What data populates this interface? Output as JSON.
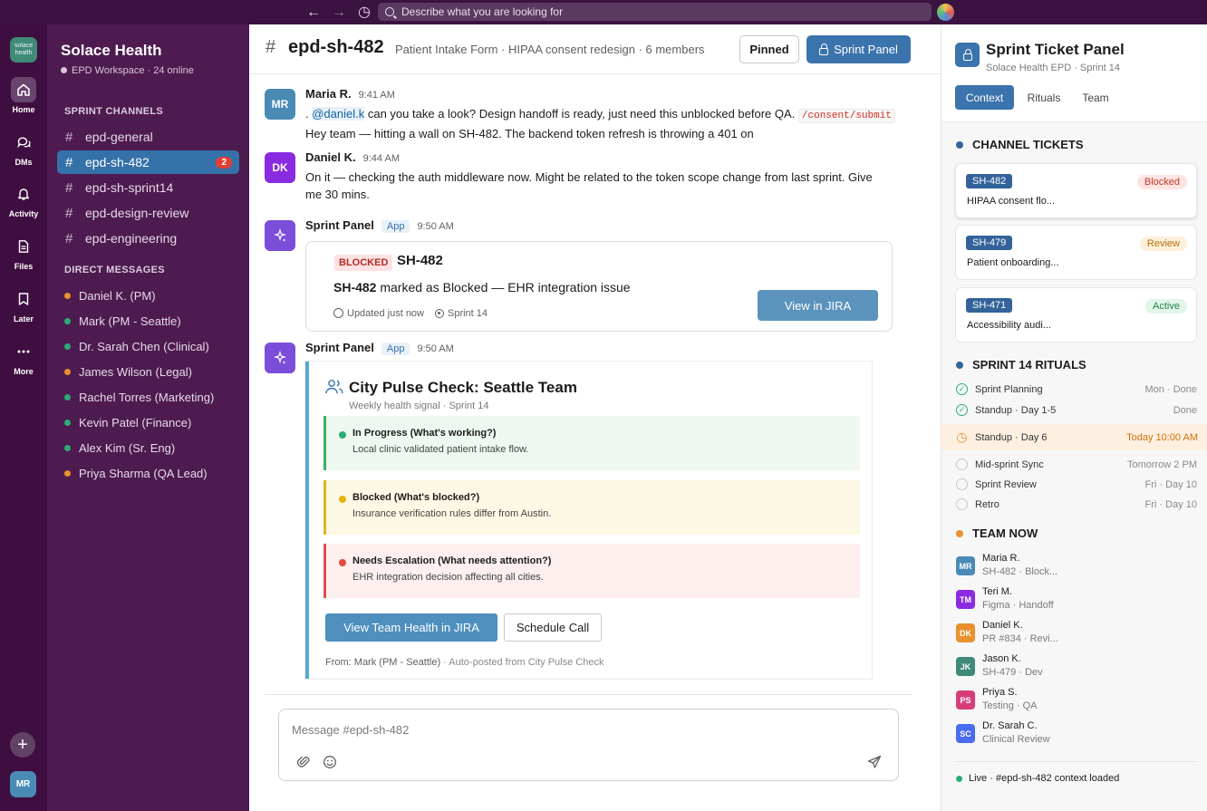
{
  "topbar": {
    "back": "←",
    "forward": "→",
    "history": "◷",
    "search_placeholder": "Describe what you are looking for"
  },
  "rail": {
    "workspace_logo": "solace health",
    "items": [
      {
        "label": "Home",
        "icon": "home-icon"
      },
      {
        "label": "DMs",
        "icon": "dms-icon"
      },
      {
        "label": "Activity",
        "icon": "bell-icon"
      },
      {
        "label": "Files",
        "icon": "file-icon"
      },
      {
        "label": "Later",
        "icon": "bookmark-icon"
      },
      {
        "label": "More",
        "icon": "more-icon"
      }
    ],
    "add": "+",
    "me": "MR"
  },
  "sidebar": {
    "workspace": "Solace Health",
    "subtitle": "EPD Workspace · 24 online",
    "channels_header": "SPRINT CHANNELS",
    "channels": [
      {
        "name": "epd-general"
      },
      {
        "name": "epd-sh-482",
        "badge": "2"
      },
      {
        "name": "epd-sh-sprint14"
      },
      {
        "name": "epd-design-review"
      },
      {
        "name": "epd-engineering"
      }
    ],
    "dm_header": "DIRECT MESSAGES",
    "dms": [
      {
        "name": "Daniel K. (PM)",
        "status": "#e8912d"
      },
      {
        "name": "Mark (PM - Seattle)",
        "status": "#2bac76"
      },
      {
        "name": "Dr. Sarah Chen (Clinical)",
        "status": "#2bac76"
      },
      {
        "name": "James Wilson (Legal)",
        "status": "#e8912d"
      },
      {
        "name": "Rachel Torres (Marketing)",
        "status": "#2bac76"
      },
      {
        "name": "Kevin Patel (Finance)",
        "status": "#2bac76"
      },
      {
        "name": "Alex Kim (Sr. Eng)",
        "status": "#2bac76"
      },
      {
        "name": "Priya Sharma (QA Lead)",
        "status": "#e8912d"
      }
    ]
  },
  "channel": {
    "hash": "#",
    "name": "epd-sh-482",
    "description": "Patient Intake Form · HIPAA consent redesign · 6 members",
    "pinned_label": "Pinned",
    "sprint_panel_label": "Sprint Panel"
  },
  "messages": {
    "m1": {
      "initials": "MR",
      "author": "Maria R.",
      "time": "9:41 AM",
      "lead": ". ",
      "mention": "@daniel.k",
      "text": " can you take a look? Design handoff is ready, just need this unblocked before QA. ",
      "code": "/consent/submit",
      "line2": "Hey team — hitting a wall on SH-482. The backend token refresh is throwing a 401 on"
    },
    "m2": {
      "initials": "DK",
      "author": "Daniel K.",
      "time": "9:44 AM",
      "text": "On it — checking the auth middleware now. Might be related to the token scope change from last sprint. Give me 30 mins."
    },
    "m3": {
      "author": "Sprint Panel",
      "app": "App",
      "time": "9:50 AM",
      "card": {
        "tag": "BLOCKED",
        "id": "SH-482",
        "id_bold": "SH-482",
        "status_text": " marked as Blocked — EHR integration issue",
        "updated": "Updated just now",
        "sprint": "Sprint 14",
        "button": "View in JIRA"
      }
    },
    "m4": {
      "author": "Sprint Panel",
      "app": "App",
      "time": "9:50 AM",
      "card": {
        "title": "City Pulse Check: Seattle Team",
        "subtitle": "Weekly health signal · Sprint 14",
        "sections": [
          {
            "title": "In Progress (What's working?)",
            "desc": "Local clinic validated patient intake flow.",
            "color": "#2bac76",
            "bg": "#eef8f1",
            "border": "#3fae6a"
          },
          {
            "title": "Blocked (What's blocked?)",
            "desc": "Insurance verification rules differ from Austin.",
            "color": "#e8b20c",
            "bg": "#fdf8e4",
            "border": "#e0b421"
          },
          {
            "title": "Needs Escalation (What needs attention?)",
            "desc": "EHR integration decision affecting all cities.",
            "color": "#e0493f",
            "bg": "#fcefee",
            "border": "#d9534f"
          }
        ],
        "btn_health": "View Team Health in JIRA",
        "btn_schedule": "Schedule Call",
        "from": "From: Mark (PM - Seattle)",
        "auto": " · Auto-posted from City Pulse Check"
      }
    }
  },
  "composer": {
    "placeholder": "Message #epd-sh-482",
    "attach": "⎘",
    "emoji": "☺",
    "send": "➤"
  },
  "panel": {
    "title": "Sprint Ticket Panel",
    "subtitle": "Solace Health EPD · Sprint 14",
    "tabs": [
      "Context",
      "Rituals",
      "Team"
    ],
    "tickets_header": "CHANNEL TICKETS",
    "tickets": [
      {
        "id": "SH-482",
        "status": "Blocked",
        "title": "HIPAA consent flo...",
        "fg": "#c0392b",
        "bg": "#fde4e2"
      },
      {
        "id": "SH-479",
        "status": "Review",
        "title": "Patient onboarding...",
        "fg": "#b86e10",
        "bg": "#fdf0da"
      },
      {
        "id": "SH-471",
        "status": "Active",
        "title": "Accessibility audi...",
        "fg": "#23874c",
        "bg": "#e3f5e9"
      }
    ],
    "rituals_header": "SPRINT 14 RITUALS",
    "rituals": [
      {
        "name": "Sprint Planning",
        "when": "Mon · Done",
        "state": "done"
      },
      {
        "name": "Standup · Day 1-5",
        "when": "Done",
        "state": "done"
      },
      {
        "name": "Standup · Day 6",
        "when": "Today 10:00 AM",
        "state": "now"
      },
      {
        "name": "Mid-sprint Sync",
        "when": "Tomorrow 2 PM",
        "state": "todo"
      },
      {
        "name": "Sprint Review",
        "when": "Fri · Day 10",
        "state": "todo"
      },
      {
        "name": "Retro",
        "when": "Fri · Day 10",
        "state": "todo"
      }
    ],
    "team_header": "TEAM NOW",
    "team": [
      {
        "initials": "MR",
        "name": "Maria R.",
        "status": "SH-482 · Block...",
        "color": "#4a8bb5"
      },
      {
        "initials": "TM",
        "name": "Teri M.",
        "status": "Figma · Handoff",
        "color": "#8a2be2"
      },
      {
        "initials": "DK",
        "name": "Daniel K.",
        "status": "PR #834 · Revi...",
        "color": "#e8912d"
      },
      {
        "initials": "JK",
        "name": "Jason K.",
        "status": "SH-479 · Dev",
        "color": "#3f8a78"
      },
      {
        "initials": "PS",
        "name": "Priya S.",
        "status": "Testing · QA",
        "color": "#d63e7a"
      },
      {
        "initials": "SC",
        "name": "Dr. Sarah C.",
        "status": "Clinical Review",
        "color": "#4a6cf0"
      }
    ],
    "live": "Live · #epd-sh-482 context loaded"
  }
}
